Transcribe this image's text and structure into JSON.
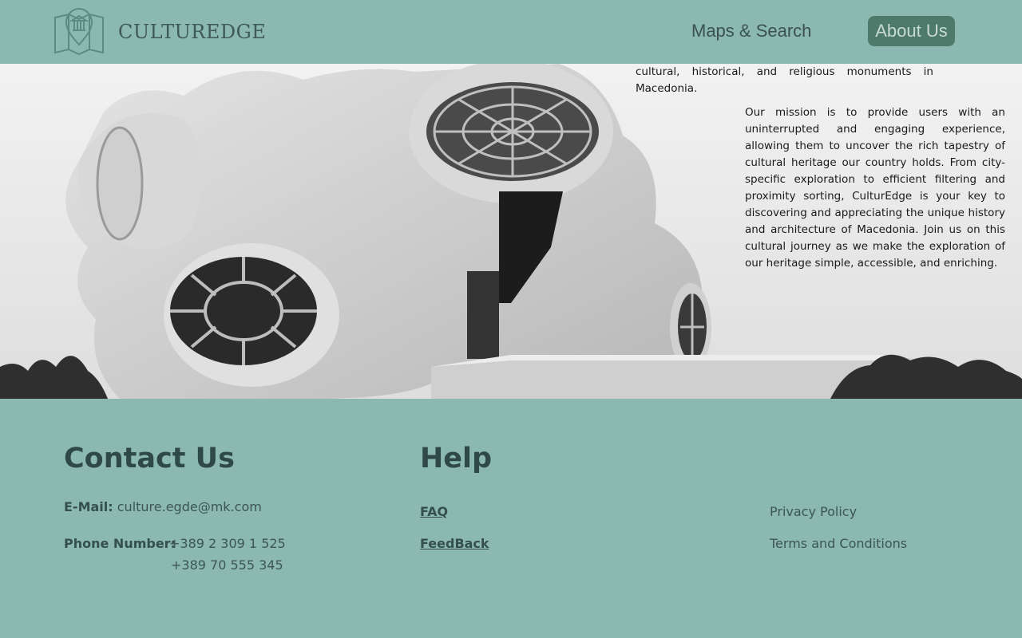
{
  "header": {
    "logo_text": "CULTUREDGE",
    "logo_icon": "museum-map-icon",
    "nav": {
      "maps_search": "Maps & Search",
      "about_us": "About Us"
    }
  },
  "hero": {
    "intro_text": "cultural, historical, and religious monuments in Macedonia.",
    "mission_text": "Our mission is to provide users with an uninterrupted and engaging experience, allowing them to uncover the rich tapestry of cultural heritage our country holds. From city-specific exploration to efficient filtering and proximity sorting, CulturEdge is your key to discovering and appreciating the unique history and architecture of Macedonia. Join us on this cultural journey as we make the exploration of our heritage simple, accessible, and enriching."
  },
  "footer": {
    "contact": {
      "heading": "Contact Us",
      "email_label": "E-Mail:",
      "email_value": "culture.egde@mk.com",
      "phone_label": "Phone Number:",
      "phone_1": "+389 2 309 1 525",
      "phone_2": "+389 70 555 345"
    },
    "help": {
      "heading": "Help",
      "faq": "FAQ",
      "feedback": "FeedBack"
    },
    "legal": {
      "privacy": "Privacy Policy",
      "terms": "Terms and Conditions"
    }
  },
  "colors": {
    "brand_teal": "#8bb8b1",
    "button_green": "#4d7a6b",
    "heading_dark": "#2f4947"
  }
}
